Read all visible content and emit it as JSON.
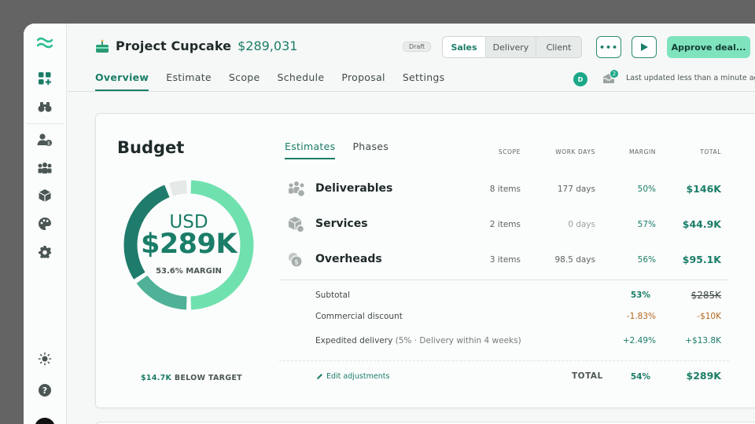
{
  "project": {
    "name": "Project Cupcake",
    "amount": "$289,031",
    "status_badge": "Draft"
  },
  "view_switch": [
    "Sales",
    "Delivery",
    "Client"
  ],
  "actions": {
    "more_label": "•••",
    "approve_label": "Approve deal..."
  },
  "tabs": [
    "Overview",
    "Estimate",
    "Scope",
    "Schedule",
    "Proposal",
    "Settings"
  ],
  "header_meta": {
    "avatar_initial": "D",
    "inbox_count": "2",
    "updated": "Last updated less than a minute ago"
  },
  "budget": {
    "title": "Budget",
    "currency": "USD",
    "amount": "$289K",
    "margin": "53.6% MARGIN",
    "below_amount": "$14.7K",
    "below_label": "BELOW TARGET"
  },
  "donut": {
    "segments": [
      {
        "fraction": 0.5,
        "color": "#6fe1ae"
      },
      {
        "fraction": 0.155,
        "color": "#4fb197"
      },
      {
        "fraction": 0.29,
        "color": "#1f7c6c"
      },
      {
        "fraction": 0.055,
        "color": "#e4e8e6"
      }
    ]
  },
  "estimate_tabs": [
    "Estimates",
    "Phases"
  ],
  "columns": [
    "SCOPE",
    "WORK DAYS",
    "MARGIN",
    "TOTAL"
  ],
  "rows": [
    {
      "name": "Deliverables",
      "icon": "people-icon",
      "scope": "8 items",
      "days": "177 days",
      "margin": "50%",
      "total": "$146K"
    },
    {
      "name": "Services",
      "icon": "box-icon",
      "scope": "2 items",
      "days": "0 days",
      "margin": "57%",
      "total": "$44.9K"
    },
    {
      "name": "Overheads",
      "icon": "coins-icon",
      "scope": "3 items",
      "days": "98.5 days",
      "margin": "56%",
      "total": "$95.1K"
    }
  ],
  "adjustments": {
    "subtotal": {
      "label": "Subtotal",
      "margin": "53%",
      "total": "$285K"
    },
    "discount": {
      "label": "Commercial discount",
      "margin": "-1.83%",
      "total": "-$10K"
    },
    "expedited": {
      "label": "Expedited delivery",
      "note": "(5% · Delivery within 4 weeks)",
      "margin": "+2.49%",
      "total": "+$13.8K"
    }
  },
  "footer": {
    "edit_label": "Edit adjustments",
    "total_label": "TOTAL",
    "total_margin": "54%",
    "total_value": "$289K"
  },
  "colors": {
    "accent": "#1a7d68",
    "approve": "#7fe3be",
    "discount": "#b4661d"
  }
}
